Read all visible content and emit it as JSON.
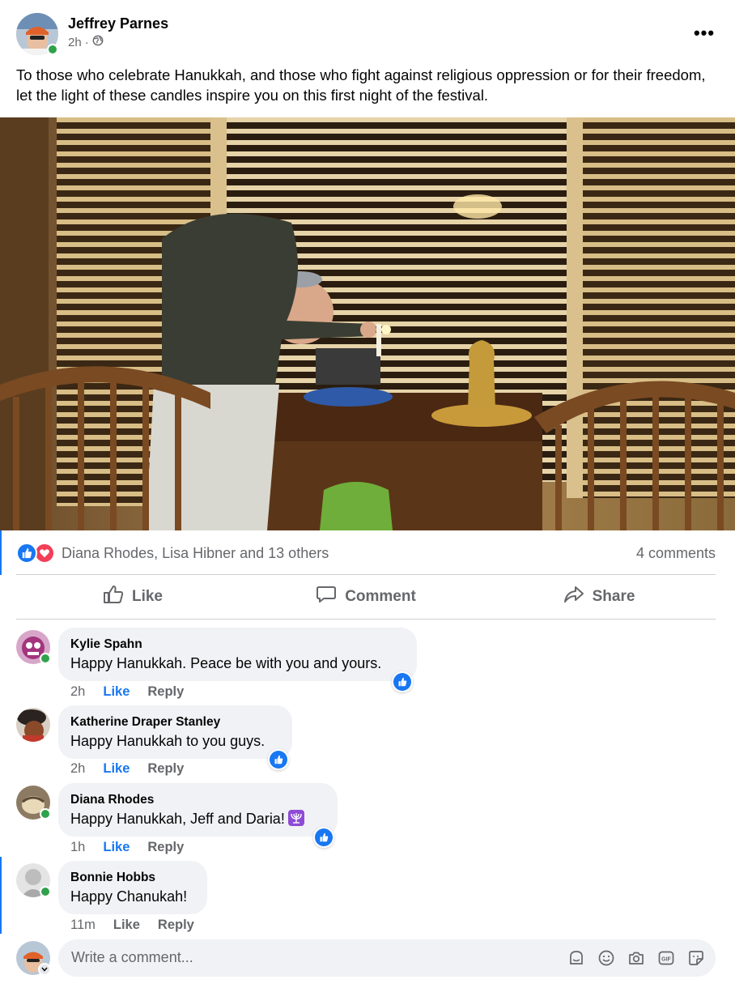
{
  "post": {
    "author": "Jeffrey Parnes",
    "time": "2h",
    "text": "To those who celebrate Hanukkah, and those who fight against religious oppression or for their freedom, let the light of these candles inspire you on this first night of the festival.",
    "reactions_text": "Diana Rhodes, Lisa Hibner and 13 others",
    "comments_count": "4 comments"
  },
  "actions": {
    "like": "Like",
    "comment": "Comment",
    "share": "Share"
  },
  "comments": [
    {
      "name": "Kylie Spahn",
      "text": "Happy Hanukkah. Peace be with you and yours.",
      "time": "2h",
      "like": "Like",
      "reply": "Reply",
      "liked": true
    },
    {
      "name": "Katherine Draper Stanley",
      "text": "Happy Hanukkah to you guys.",
      "time": "2h",
      "like": "Like",
      "reply": "Reply",
      "liked": true
    },
    {
      "name": "Diana Rhodes",
      "text": "Happy Hanukkah, Jeff and Daria!",
      "time": "1h",
      "like": "Like",
      "reply": "Reply",
      "liked": true
    },
    {
      "name": "Bonnie Hobbs",
      "text": "Happy Chanukah!",
      "time": "11m",
      "like": "Like",
      "reply": "Reply",
      "liked": false
    }
  ],
  "composer": {
    "placeholder": "Write a comment..."
  },
  "colors": {
    "accent": "#1877f2",
    "love": "#f33e58",
    "online": "#31a24c",
    "bubble": "#f0f2f5",
    "muted": "#65676b"
  }
}
